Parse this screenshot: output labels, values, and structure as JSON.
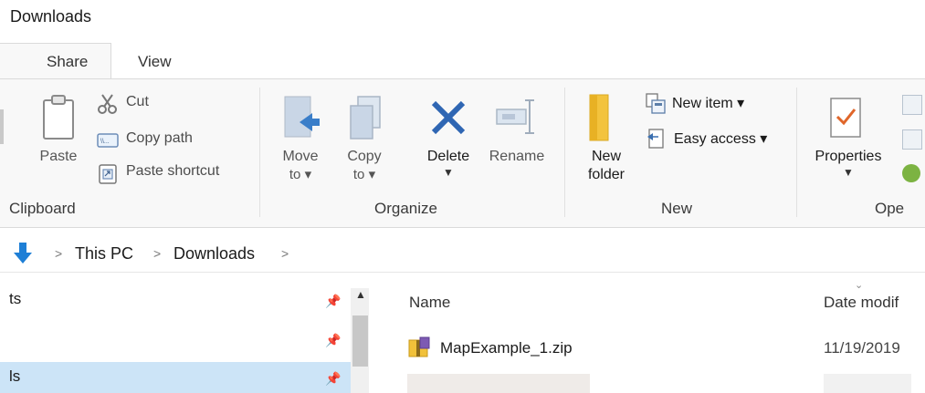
{
  "window": {
    "title": "Downloads"
  },
  "tabs": [
    {
      "label": "Share"
    },
    {
      "label": "View"
    }
  ],
  "ribbon": {
    "clipboard": {
      "paste": "Paste",
      "cut": "Cut",
      "copy_path": "Copy path",
      "paste_shortcut": "Paste shortcut",
      "group": "Clipboard"
    },
    "organize": {
      "move_to": [
        "Move",
        "to ▾"
      ],
      "copy_to": [
        "Copy",
        "to ▾"
      ],
      "delete": "Delete",
      "rename": "Rename",
      "group": "Organize"
    },
    "new": {
      "new_folder": [
        "New",
        "folder"
      ],
      "new_item": "New item ▾",
      "easy_access": "Easy access ▾",
      "group": "New"
    },
    "open": {
      "properties": "Properties",
      "group": "Ope"
    }
  },
  "address": {
    "crumbs": [
      "This PC",
      "Downloads"
    ]
  },
  "nav": {
    "items": [
      {
        "label": "ts",
        "selected": false
      },
      {
        "label": "",
        "selected": false
      },
      {
        "label": "ls",
        "selected": true
      }
    ]
  },
  "files": {
    "columns": {
      "name": "Name",
      "date": "Date modif"
    },
    "rows": [
      {
        "name": "MapExample_1.zip",
        "date": "11/19/2019"
      }
    ]
  },
  "colors": {
    "accent": "#1e7fd6",
    "selection": "#cce4f7",
    "ribbon_bg": "#f8f8f8",
    "delete_x": "#2b6cc4"
  }
}
